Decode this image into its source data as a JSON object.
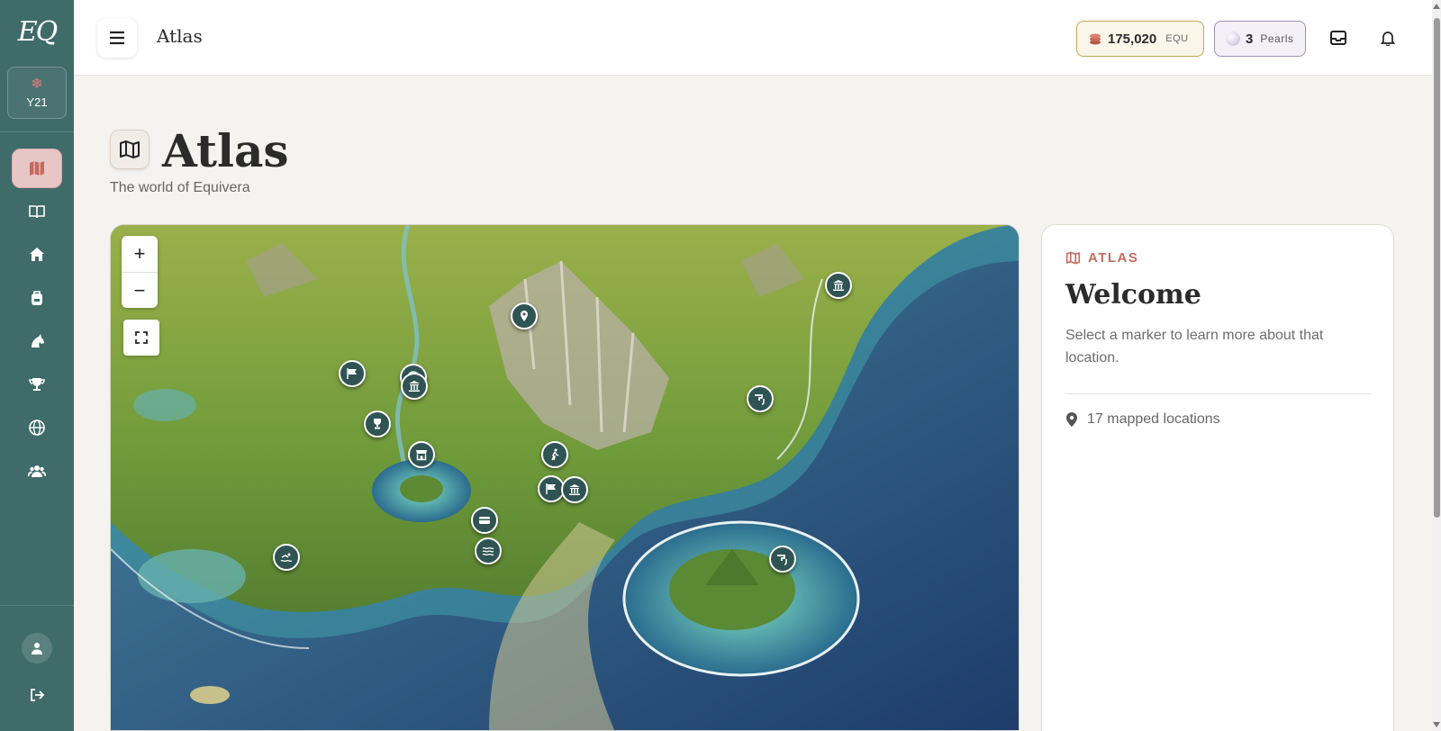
{
  "app": {
    "logo_text": "EQ",
    "year_label": "Y21"
  },
  "sidebar": {
    "items": [
      {
        "icon": "map-icon",
        "active": true
      },
      {
        "icon": "book-icon",
        "active": false
      },
      {
        "icon": "home-icon",
        "active": false
      },
      {
        "icon": "backpack-icon",
        "active": false
      },
      {
        "icon": "horse-icon",
        "active": false
      },
      {
        "icon": "trophy-icon",
        "active": false
      },
      {
        "icon": "globe-icon",
        "active": false
      },
      {
        "icon": "users-icon",
        "active": false
      }
    ]
  },
  "topbar": {
    "title": "Atlas",
    "equ": {
      "amount": "175,020",
      "unit": "EQU"
    },
    "pearls": {
      "amount": "3",
      "unit": "Pearls"
    }
  },
  "header": {
    "title": "Atlas",
    "subtitle": "The world of Equivera"
  },
  "map": {
    "zoom_in": "+",
    "zoom_out": "−",
    "markers": [
      {
        "name": "museum",
        "icon": "museum-icon"
      },
      {
        "name": "pin",
        "icon": "pin-icon"
      },
      {
        "name": "flag",
        "icon": "flag-icon"
      },
      {
        "name": "stable",
        "icon": "stable-icon"
      },
      {
        "name": "museum",
        "icon": "museum-icon"
      },
      {
        "name": "trophy",
        "icon": "trophy-icon"
      },
      {
        "name": "shop",
        "icon": "shop-icon"
      },
      {
        "name": "riding",
        "icon": "hiker-icon"
      },
      {
        "name": "flag",
        "icon": "flag-icon"
      },
      {
        "name": "museum",
        "icon": "museum-icon"
      },
      {
        "name": "card",
        "icon": "card-icon"
      },
      {
        "name": "water",
        "icon": "water-icon"
      },
      {
        "name": "swim",
        "icon": "swim-icon"
      },
      {
        "name": "tap",
        "icon": "tap-icon"
      },
      {
        "name": "tap",
        "icon": "tap-icon"
      }
    ]
  },
  "panel": {
    "kicker": "ATLAS",
    "title": "Welcome",
    "text": "Select a marker to learn more about that location.",
    "count": "17 mapped locations"
  },
  "colors": {
    "sidebar": "#3f6b69",
    "accent": "#c46b5e",
    "marker": "#2f5453",
    "gold": "#c9a35a",
    "pearl": "#9e90b9"
  }
}
